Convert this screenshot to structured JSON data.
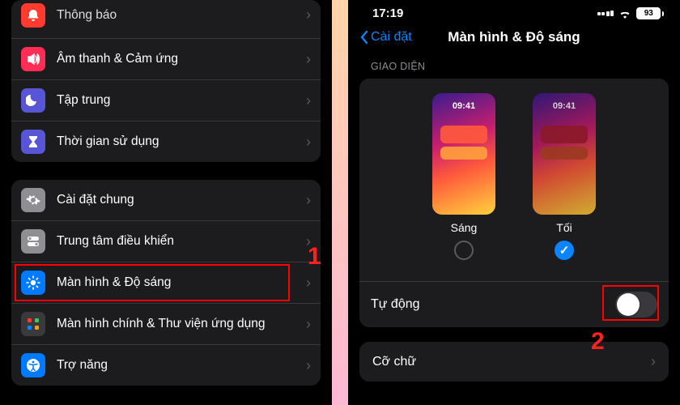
{
  "left": {
    "items_top": [
      {
        "label": "Thông báo",
        "icon": "bell",
        "color": "#ff3b30"
      },
      {
        "label": "Âm thanh & Cảm ứng",
        "icon": "speaker",
        "color": "#ff2d55"
      },
      {
        "label": "Tập trung",
        "icon": "moon",
        "color": "#5856d6"
      },
      {
        "label": "Thời gian sử dụng",
        "icon": "hourglass",
        "color": "#5856d6"
      }
    ],
    "items_bottom": [
      {
        "label": "Cài đặt chung",
        "icon": "gear",
        "color": "#8e8e93"
      },
      {
        "label": "Trung tâm điều khiển",
        "icon": "switches",
        "color": "#8e8e93"
      },
      {
        "label": "Màn hình & Độ sáng",
        "icon": "brightness",
        "color": "#007aff",
        "highlight": true
      },
      {
        "label": "Màn hình chính & Thư viện ứng dụng",
        "icon": "grid",
        "color": "#3a3a3c"
      },
      {
        "label": "Trợ năng",
        "icon": "access",
        "color": "#007aff"
      }
    ],
    "callout": "1"
  },
  "right": {
    "status": {
      "time": "17:19",
      "battery": "93"
    },
    "back_label": "Cài đặt",
    "title": "Màn hình & Độ sáng",
    "section_appearance": "GIAO DIỆN",
    "light_label": "Sáng",
    "dark_label": "Tối",
    "thumb_time": "09:41",
    "auto_label": "Tự động",
    "text_size_label": "Cỡ chữ",
    "callout": "2"
  }
}
